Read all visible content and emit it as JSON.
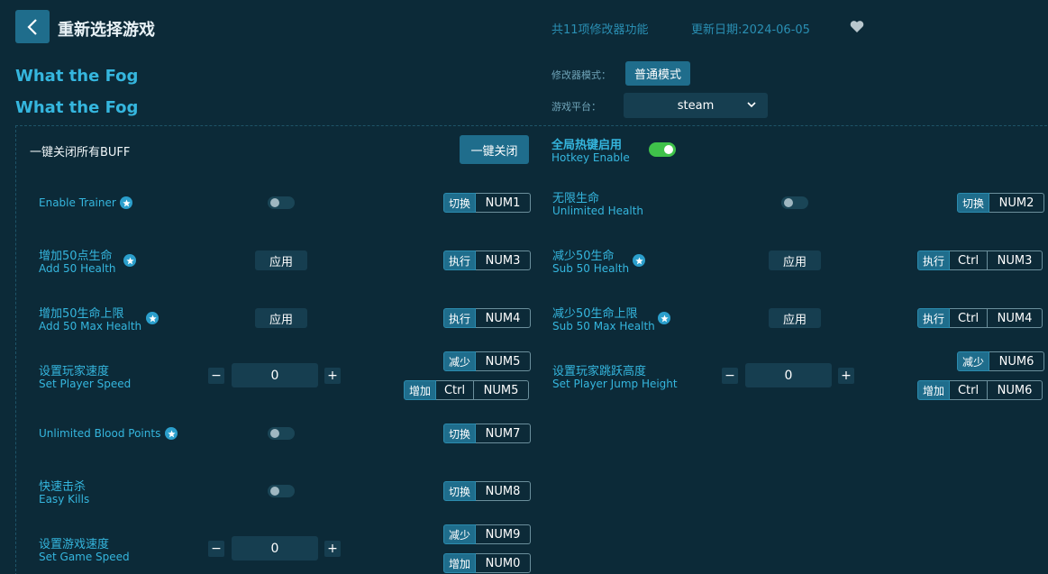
{
  "header": {
    "title": "重新选择游戏",
    "feature_count": "共11项修改器功能",
    "update_date": "更新日期:2024-06-05"
  },
  "game": {
    "title_1": "What the Fog",
    "title_2": "What the Fog"
  },
  "settings": {
    "mode_label": "修改器模式：",
    "mode_value": "普通模式",
    "platform_label": "游戏平台：",
    "platform_value": "steam"
  },
  "global": {
    "close_all_label": "一键关闭所有BUFF",
    "close_all_button": "一键关闭",
    "hotkey_cn": "全局热键启用",
    "hotkey_en": "Hotkey Enable",
    "hotkey_enabled": true
  },
  "left": [
    {
      "en": "Enable Trainer",
      "star": true,
      "control": "toggle",
      "keys": [
        {
          "tag": "切换",
          "keys": [
            "NUM1"
          ]
        }
      ]
    },
    {
      "cn": "增加50点生命",
      "en": "Add 50 Health",
      "star": true,
      "control": "apply",
      "apply_label": "应用",
      "keys": [
        {
          "tag": "执行",
          "keys": [
            "NUM3"
          ]
        }
      ]
    },
    {
      "cn": "增加50生命上限",
      "en": "Add 50 Max Health",
      "star": true,
      "control": "apply",
      "apply_label": "应用",
      "keys": [
        {
          "tag": "执行",
          "keys": [
            "NUM4"
          ]
        }
      ]
    },
    {
      "cn": "设置玩家速度",
      "en": "Set Player Speed",
      "control": "stepper",
      "value": "0",
      "keys": [
        {
          "tag": "减少",
          "keys": [
            "NUM5"
          ]
        },
        {
          "tag": "增加",
          "keys": [
            "Ctrl",
            "NUM5"
          ]
        }
      ]
    },
    {
      "en": "Unlimited Blood Points",
      "star": true,
      "control": "toggle",
      "keys": [
        {
          "tag": "切换",
          "keys": [
            "NUM7"
          ]
        }
      ]
    },
    {
      "cn": "快速击杀",
      "en": "Easy Kills",
      "control": "toggle",
      "keys": [
        {
          "tag": "切换",
          "keys": [
            "NUM8"
          ]
        }
      ]
    },
    {
      "cn": "设置游戏速度",
      "en": "Set Game Speed",
      "control": "stepper",
      "value": "0",
      "keys": [
        {
          "tag": "减少",
          "keys": [
            "NUM9"
          ]
        },
        {
          "tag": "增加",
          "keys": [
            "NUM0"
          ]
        }
      ]
    }
  ],
  "right": [
    {
      "cn": "无限生命",
      "en": "Unlimited Health",
      "control": "toggle",
      "keys": [
        {
          "tag": "切换",
          "keys": [
            "NUM2"
          ]
        }
      ]
    },
    {
      "cn": "减少50生命",
      "en": "Sub 50 Health",
      "star": true,
      "control": "apply",
      "apply_label": "应用",
      "keys": [
        {
          "tag": "执行",
          "keys": [
            "Ctrl",
            "NUM3"
          ]
        }
      ]
    },
    {
      "cn": "减少50生命上限",
      "en": "Sub 50 Max Health",
      "star": true,
      "control": "apply",
      "apply_label": "应用",
      "keys": [
        {
          "tag": "执行",
          "keys": [
            "Ctrl",
            "NUM4"
          ]
        }
      ]
    },
    {
      "cn": "设置玩家跳跃高度",
      "en": "Set Player Jump Height",
      "control": "stepper",
      "value": "0",
      "keys": [
        {
          "tag": "减少",
          "keys": [
            "NUM6"
          ]
        },
        {
          "tag": "增加",
          "keys": [
            "Ctrl",
            "NUM6"
          ]
        }
      ]
    }
  ],
  "icons": {
    "back": "chevron-left-icon",
    "favorite": "heart-icon",
    "dropdown": "chevron-down-icon",
    "star": "star-icon"
  },
  "colors": {
    "background": "#0c2a38",
    "accent": "#35b6de",
    "button": "#1f6d8c",
    "toggle_on": "#3fc24a"
  }
}
